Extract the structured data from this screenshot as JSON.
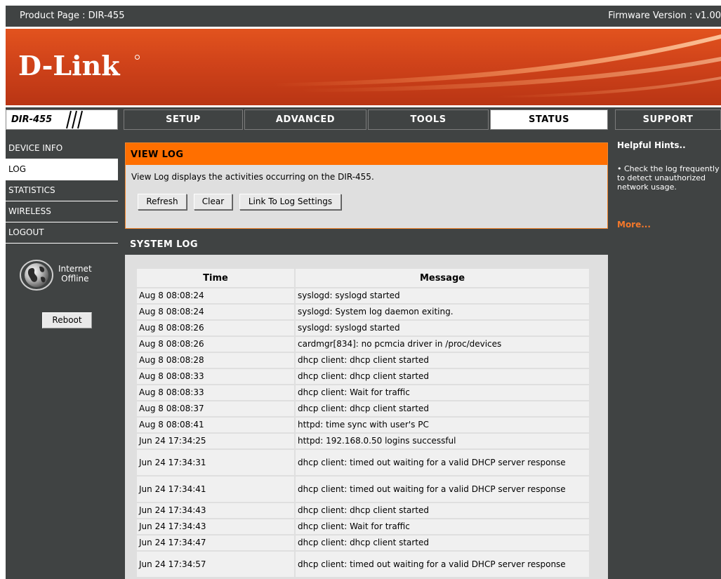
{
  "topbar": {
    "product": "Product Page : DIR-455",
    "firmware": "Firmware Version : v1.00"
  },
  "brand": {
    "logo": "D-Link",
    "model": "DIR-455"
  },
  "nav": {
    "tabs": [
      {
        "label": "SETUP",
        "active": false
      },
      {
        "label": "ADVANCED",
        "active": false
      },
      {
        "label": "TOOLS",
        "active": false
      },
      {
        "label": "STATUS",
        "active": true
      },
      {
        "label": "SUPPORT",
        "active": false
      }
    ]
  },
  "sidebar": {
    "items": [
      {
        "label": "DEVICE INFO",
        "active": false
      },
      {
        "label": "LOG",
        "active": true
      },
      {
        "label": "STATISTICS",
        "active": false
      },
      {
        "label": "WIRELESS",
        "active": false
      },
      {
        "label": "LOGOUT",
        "active": false
      }
    ],
    "internet_label": "Internet",
    "internet_status": "Offline",
    "reboot_label": "Reboot"
  },
  "viewlog": {
    "title": "VIEW LOG",
    "description": "View Log displays the activities occurring on the DIR-455.",
    "buttons": {
      "refresh": "Refresh",
      "clear": "Clear",
      "link_settings": "Link To Log Settings"
    }
  },
  "syslog": {
    "title": "SYSTEM LOG",
    "columns": {
      "time": "Time",
      "message": "Message"
    },
    "rows": [
      {
        "time": "Aug 8 08:08:24",
        "message": "syslogd: syslogd started"
      },
      {
        "time": "Aug 8 08:08:24",
        "message": "syslogd: System log daemon exiting."
      },
      {
        "time": "Aug 8 08:08:26",
        "message": "syslogd: syslogd started"
      },
      {
        "time": "Aug 8 08:08:26",
        "message": "cardmgr[834]: no pcmcia driver in /proc/devices"
      },
      {
        "time": "Aug 8 08:08:28",
        "message": "dhcp client: dhcp client started"
      },
      {
        "time": "Aug 8 08:08:33",
        "message": "dhcp client: dhcp client started"
      },
      {
        "time": "Aug 8 08:08:33",
        "message": "dhcp client: Wait for traffic"
      },
      {
        "time": "Aug 8 08:08:37",
        "message": "dhcp client: dhcp client started"
      },
      {
        "time": "Aug 8 08:08:41",
        "message": "httpd: time sync with user's PC"
      },
      {
        "time": "Jun 24 17:34:25",
        "message": "httpd: 192.168.0.50 logins successful"
      },
      {
        "time": "Jun 24 17:34:31",
        "message": "dhcp client: timed out waiting for a valid DHCP server response"
      },
      {
        "time": "Jun 24 17:34:41",
        "message": "dhcp client: timed out waiting for a valid DHCP server response"
      },
      {
        "time": "Jun 24 17:34:43",
        "message": "dhcp client: dhcp client started"
      },
      {
        "time": "Jun 24 17:34:43",
        "message": "dhcp client: Wait for traffic"
      },
      {
        "time": "Jun 24 17:34:47",
        "message": "dhcp client: dhcp client started"
      },
      {
        "time": "Jun 24 17:34:57",
        "message": "dhcp client: timed out waiting for a valid DHCP server response"
      }
    ]
  },
  "hints": {
    "title": "Helpful Hints..",
    "body": "• Check the log frequently to detect unauthorized network usage.",
    "more": "More..."
  },
  "colors": {
    "frame": "#404343",
    "banner": "#d0431a",
    "section_header": "#ff6f00",
    "panel": "#dfdfdf",
    "cell": "#f0f0f0",
    "link": "#f5782a"
  },
  "icons": {
    "globe": "globe-icon"
  }
}
